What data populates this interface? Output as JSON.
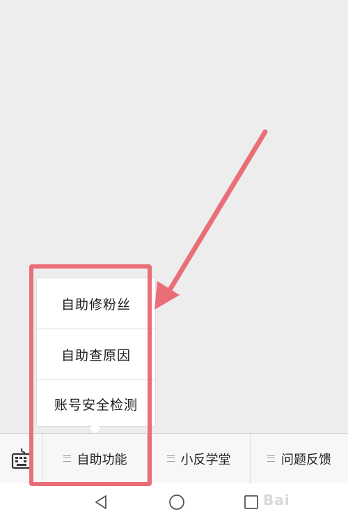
{
  "submenu": {
    "items": [
      {
        "label": "自助修粉丝"
      },
      {
        "label": "自助查原因"
      },
      {
        "label": "账号安全检测"
      }
    ]
  },
  "menu_bar": {
    "tabs": [
      {
        "label": "自助功能"
      },
      {
        "label": "小反学堂"
      },
      {
        "label": "问题反馈"
      }
    ]
  },
  "watermark": {
    "text": "Bai"
  },
  "colors": {
    "annotation": "#ea6e78",
    "background": "#ededed",
    "menu_bar": "#f7f7f7"
  }
}
